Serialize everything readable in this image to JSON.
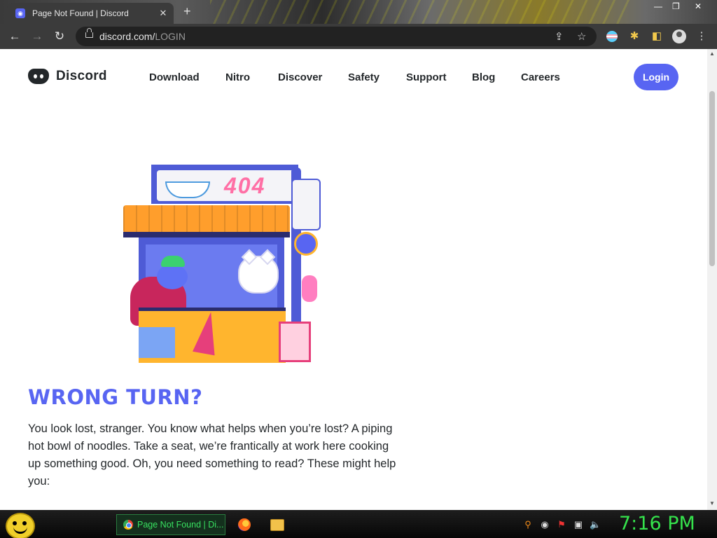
{
  "browser": {
    "tab_title": "Page Not Found | Discord",
    "tab_close": "✕",
    "new_tab": "+",
    "url_host": "discord.com/",
    "url_path": "LOGIN",
    "window_controls": [
      "—",
      "❐",
      "✕"
    ]
  },
  "site": {
    "logo_text": "Discord",
    "nav": [
      "Download",
      "Nitro",
      "Discover",
      "Safety",
      "Support",
      "Blog",
      "Careers"
    ],
    "login_label": "Login",
    "sign_text": "404",
    "heading": "WRONG TURN?",
    "paragraph": "You look lost, stranger. You know what helps when you’re lost? A piping hot bowl of noodles. Take a seat, we’re frantically at work here cooking up something good. Oh, you need something to read? These might help you:"
  },
  "taskbar": {
    "active_task_label": "Page Not Found | Di...",
    "clock": "7:16 PM"
  },
  "colors": {
    "brand": "#5865f2",
    "text_dark": "#23272a",
    "clock_green": "#35e24c"
  }
}
